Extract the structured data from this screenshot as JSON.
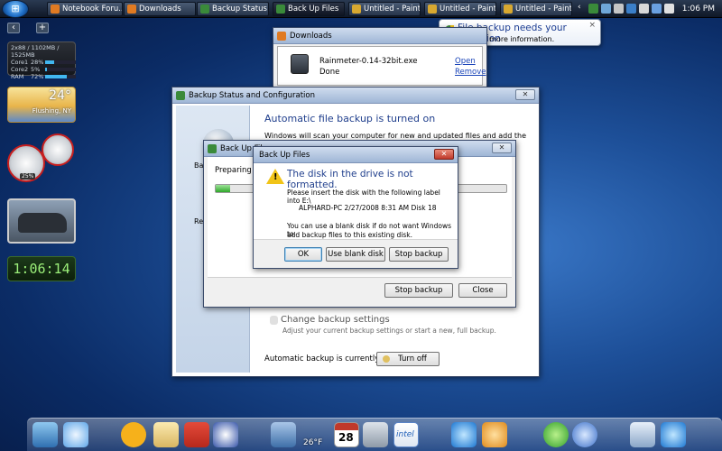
{
  "taskbar": {
    "tasks": [
      {
        "label": "Notebook Foru...",
        "color": "#e07a22"
      },
      {
        "label": "Downloads",
        "color": "#e07a22"
      },
      {
        "label": "Backup Status ...",
        "color": "#3a8a3a"
      },
      {
        "label": "Back Up Files",
        "color": "#3a8a3a"
      },
      {
        "label": "Untitled - Paint",
        "color": "#d8a830"
      },
      {
        "label": "Untitled - Paint",
        "color": "#d8a830"
      },
      {
        "label": "Untitled - Paint",
        "color": "#d8a830"
      }
    ],
    "clock": "1:06 PM"
  },
  "balloon": {
    "title": "File backup needs your attention",
    "subtitle": "Click for more information.",
    "close": "×"
  },
  "gadgets": {
    "cpu": {
      "header": "2x88 / 1102MB / 1525MB",
      "rows": [
        {
          "label": "Core1",
          "value": "28%",
          "level": 0.28
        },
        {
          "label": "Core2",
          "value": "5%",
          "level": 0.05
        },
        {
          "label": "RAM",
          "value": "72%",
          "level": 0.72
        }
      ]
    },
    "weather": {
      "temp": "24°",
      "city": "Flushing, NY"
    },
    "gauge_label": "25%",
    "clock": "1:06:14"
  },
  "downloads": {
    "title": "Downloads",
    "file_name": "Rainmeter-0.14-32bit.exe",
    "file_status": "Done",
    "open_label": "Open",
    "remove_label": "Remove"
  },
  "backup_status": {
    "title": "Backup Status and Configuration",
    "heading": "Automatic file backup is turned on",
    "description": "Windows will scan your computer for new and updated files and add them to your",
    "side_label_1": "Bac",
    "side_label_2": "Re",
    "change_title": "Change backup settings",
    "change_subtitle": "Adjust your current backup settings or start a new, full backup.",
    "status_text": "Automatic backup is currently on",
    "turn_off_label": "Turn off"
  },
  "backup_files": {
    "title": "Back Up Files",
    "preparing": "Preparing to",
    "progress": 0.05,
    "stop_label": "Stop backup",
    "close_label": "Close"
  },
  "dialog": {
    "title": "Back Up Files",
    "heading": "The disk in the drive is not formatted.",
    "line1": "Please insert the disk with the following label into E:\\",
    "line2": "ALPHARD-PC 2/27/2008 8:31 AM Disk 18",
    "line3": "You can use a blank disk if do not want Windows to",
    "line4": "add backup files to this existing disk.",
    "ok_label": "OK",
    "blank_label": "Use blank disk",
    "stop_label": "Stop backup"
  },
  "dock": {
    "temp": "26°F",
    "calendar_day": "28"
  }
}
